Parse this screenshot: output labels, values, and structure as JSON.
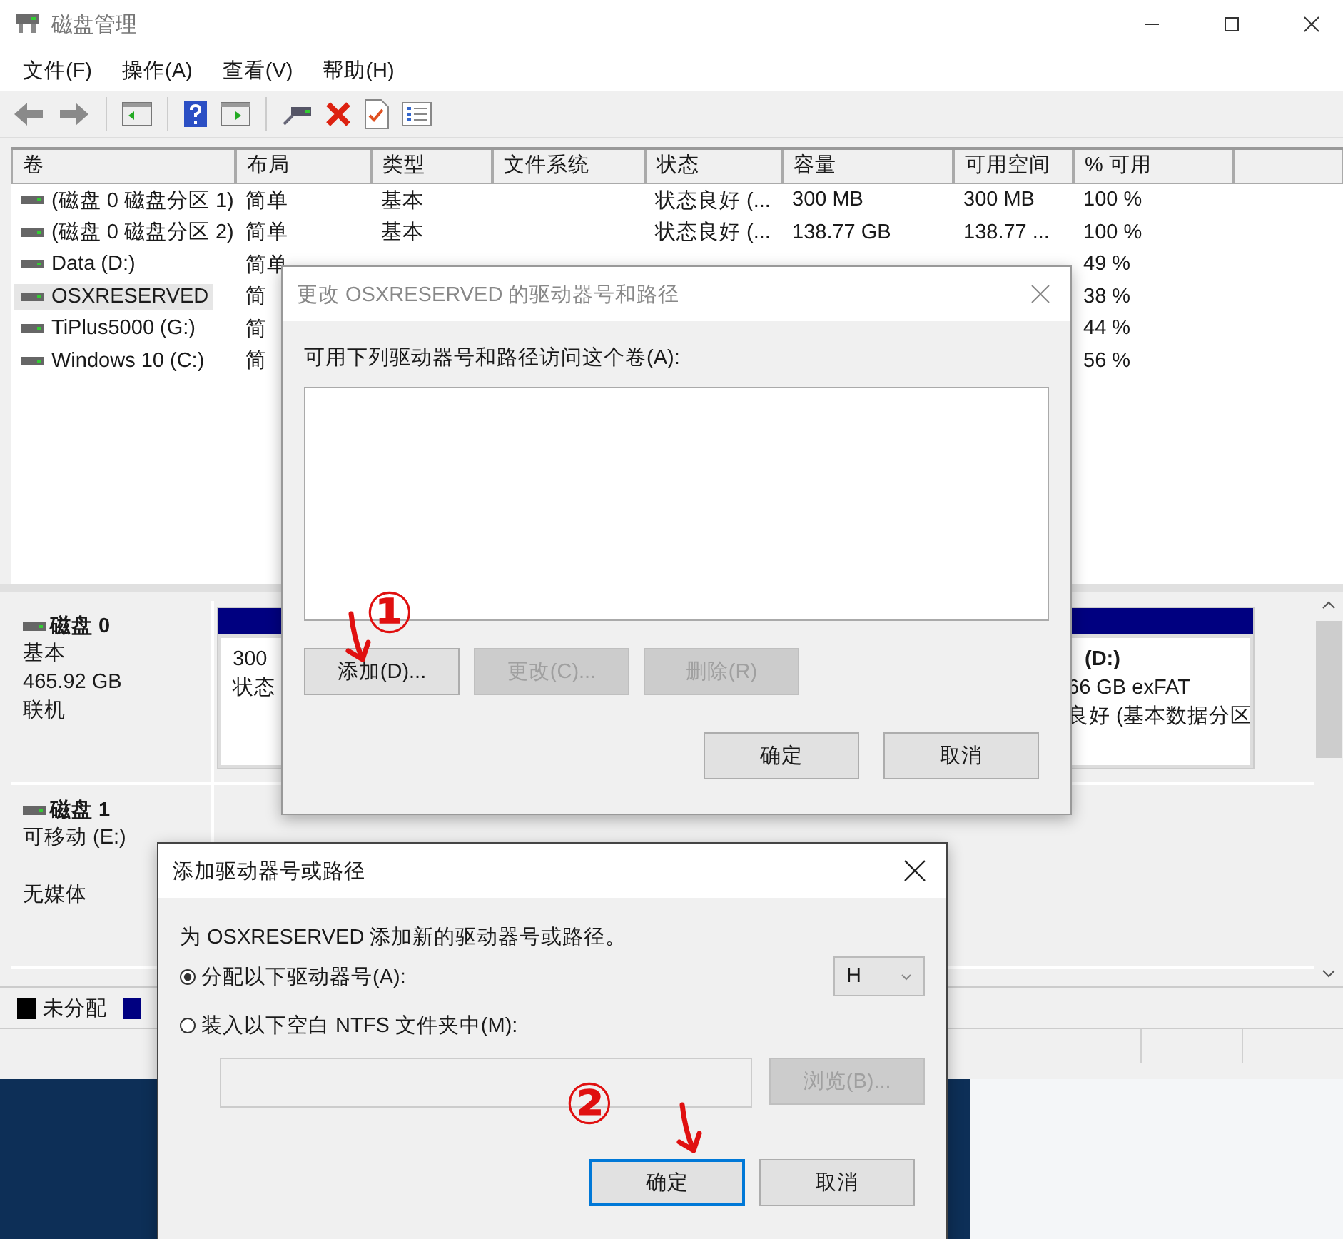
{
  "main_window": {
    "title": "磁盘管理",
    "menu": [
      "文件(F)",
      "操作(A)",
      "查看(V)",
      "帮助(H)"
    ],
    "volume_table": {
      "columns": [
        "卷",
        "布局",
        "类型",
        "文件系统",
        "状态",
        "容量",
        "可用空间",
        "% 可用"
      ],
      "rows": [
        {
          "volume": "(磁盘 0 磁盘分区 1)",
          "layout": "简单",
          "type": "基本",
          "status": "状态良好 (...",
          "capacity": "300 MB",
          "free": "300 MB",
          "percent": "100 %",
          "selected": false
        },
        {
          "volume": "(磁盘 0 磁盘分区 2)",
          "layout": "简单",
          "type": "基本",
          "status": "状态良好 (...",
          "capacity": "138.77 GB",
          "free": "138.77 ...",
          "percent": "100 %",
          "selected": false
        },
        {
          "volume": "Data (D:)",
          "layout": "简单",
          "percent": "49 %",
          "selected": false
        },
        {
          "volume": "OSXRESERVED",
          "layout": "简",
          "percent": "38 %",
          "selected": true
        },
        {
          "volume": "TiPlus5000 (G:)",
          "layout": "简",
          "percent": "44 %",
          "selected": false
        },
        {
          "volume": "Windows 10 (C:)",
          "layout": "简",
          "percent": "56 %",
          "selected": false
        }
      ]
    },
    "disks": [
      {
        "name": "磁盘 0",
        "type": "基本",
        "size": "465.92 GB",
        "status": "联机",
        "partitions": [
          {
            "lines": [
              "300",
              "状态"
            ],
            "color": "#000080"
          },
          {
            "title": "(D:)",
            "lines": [
              "66 GB exFAT",
              "良好 (基本数据分区"
            ],
            "color": "#000080"
          }
        ]
      },
      {
        "name": "磁盘 1",
        "type": "可移动 (E:)",
        "status": "无媒体"
      }
    ],
    "legend": [
      {
        "label": "未分配",
        "color": "#000000"
      },
      {
        "color": "#000080"
      }
    ]
  },
  "change_dialog": {
    "title": "更改 OSXRESERVED 的驱动器号和路径",
    "active": false,
    "label": "可用下列驱动器号和路径访问这个卷(A):",
    "buttons": [
      {
        "label": "添加(D)...",
        "disabled": false
      },
      {
        "label": "更改(C)...",
        "disabled": true
      },
      {
        "label": "删除(R)",
        "disabled": true
      }
    ],
    "footer_buttons": [
      {
        "label": "确定",
        "focused": false
      },
      {
        "label": "取消",
        "focused": false
      }
    ]
  },
  "add_dialog": {
    "title": "添加驱动器号或路径",
    "active": true,
    "text": "为 OSXRESERVED 添加新的驱动器号或路径。",
    "options": [
      {
        "label": "分配以下驱动器号(A):",
        "selected": true
      },
      {
        "label": "装入以下空白 NTFS 文件夹中(M):",
        "selected": false
      }
    ],
    "drive_letter": "H",
    "browse": {
      "label": "浏览(B)...",
      "disabled": true
    },
    "footer_buttons": [
      {
        "label": "确定",
        "focused": true
      },
      {
        "label": "取消",
        "focused": false
      }
    ]
  },
  "annotations": [
    {
      "label": "①"
    },
    {
      "label": "②"
    }
  ]
}
